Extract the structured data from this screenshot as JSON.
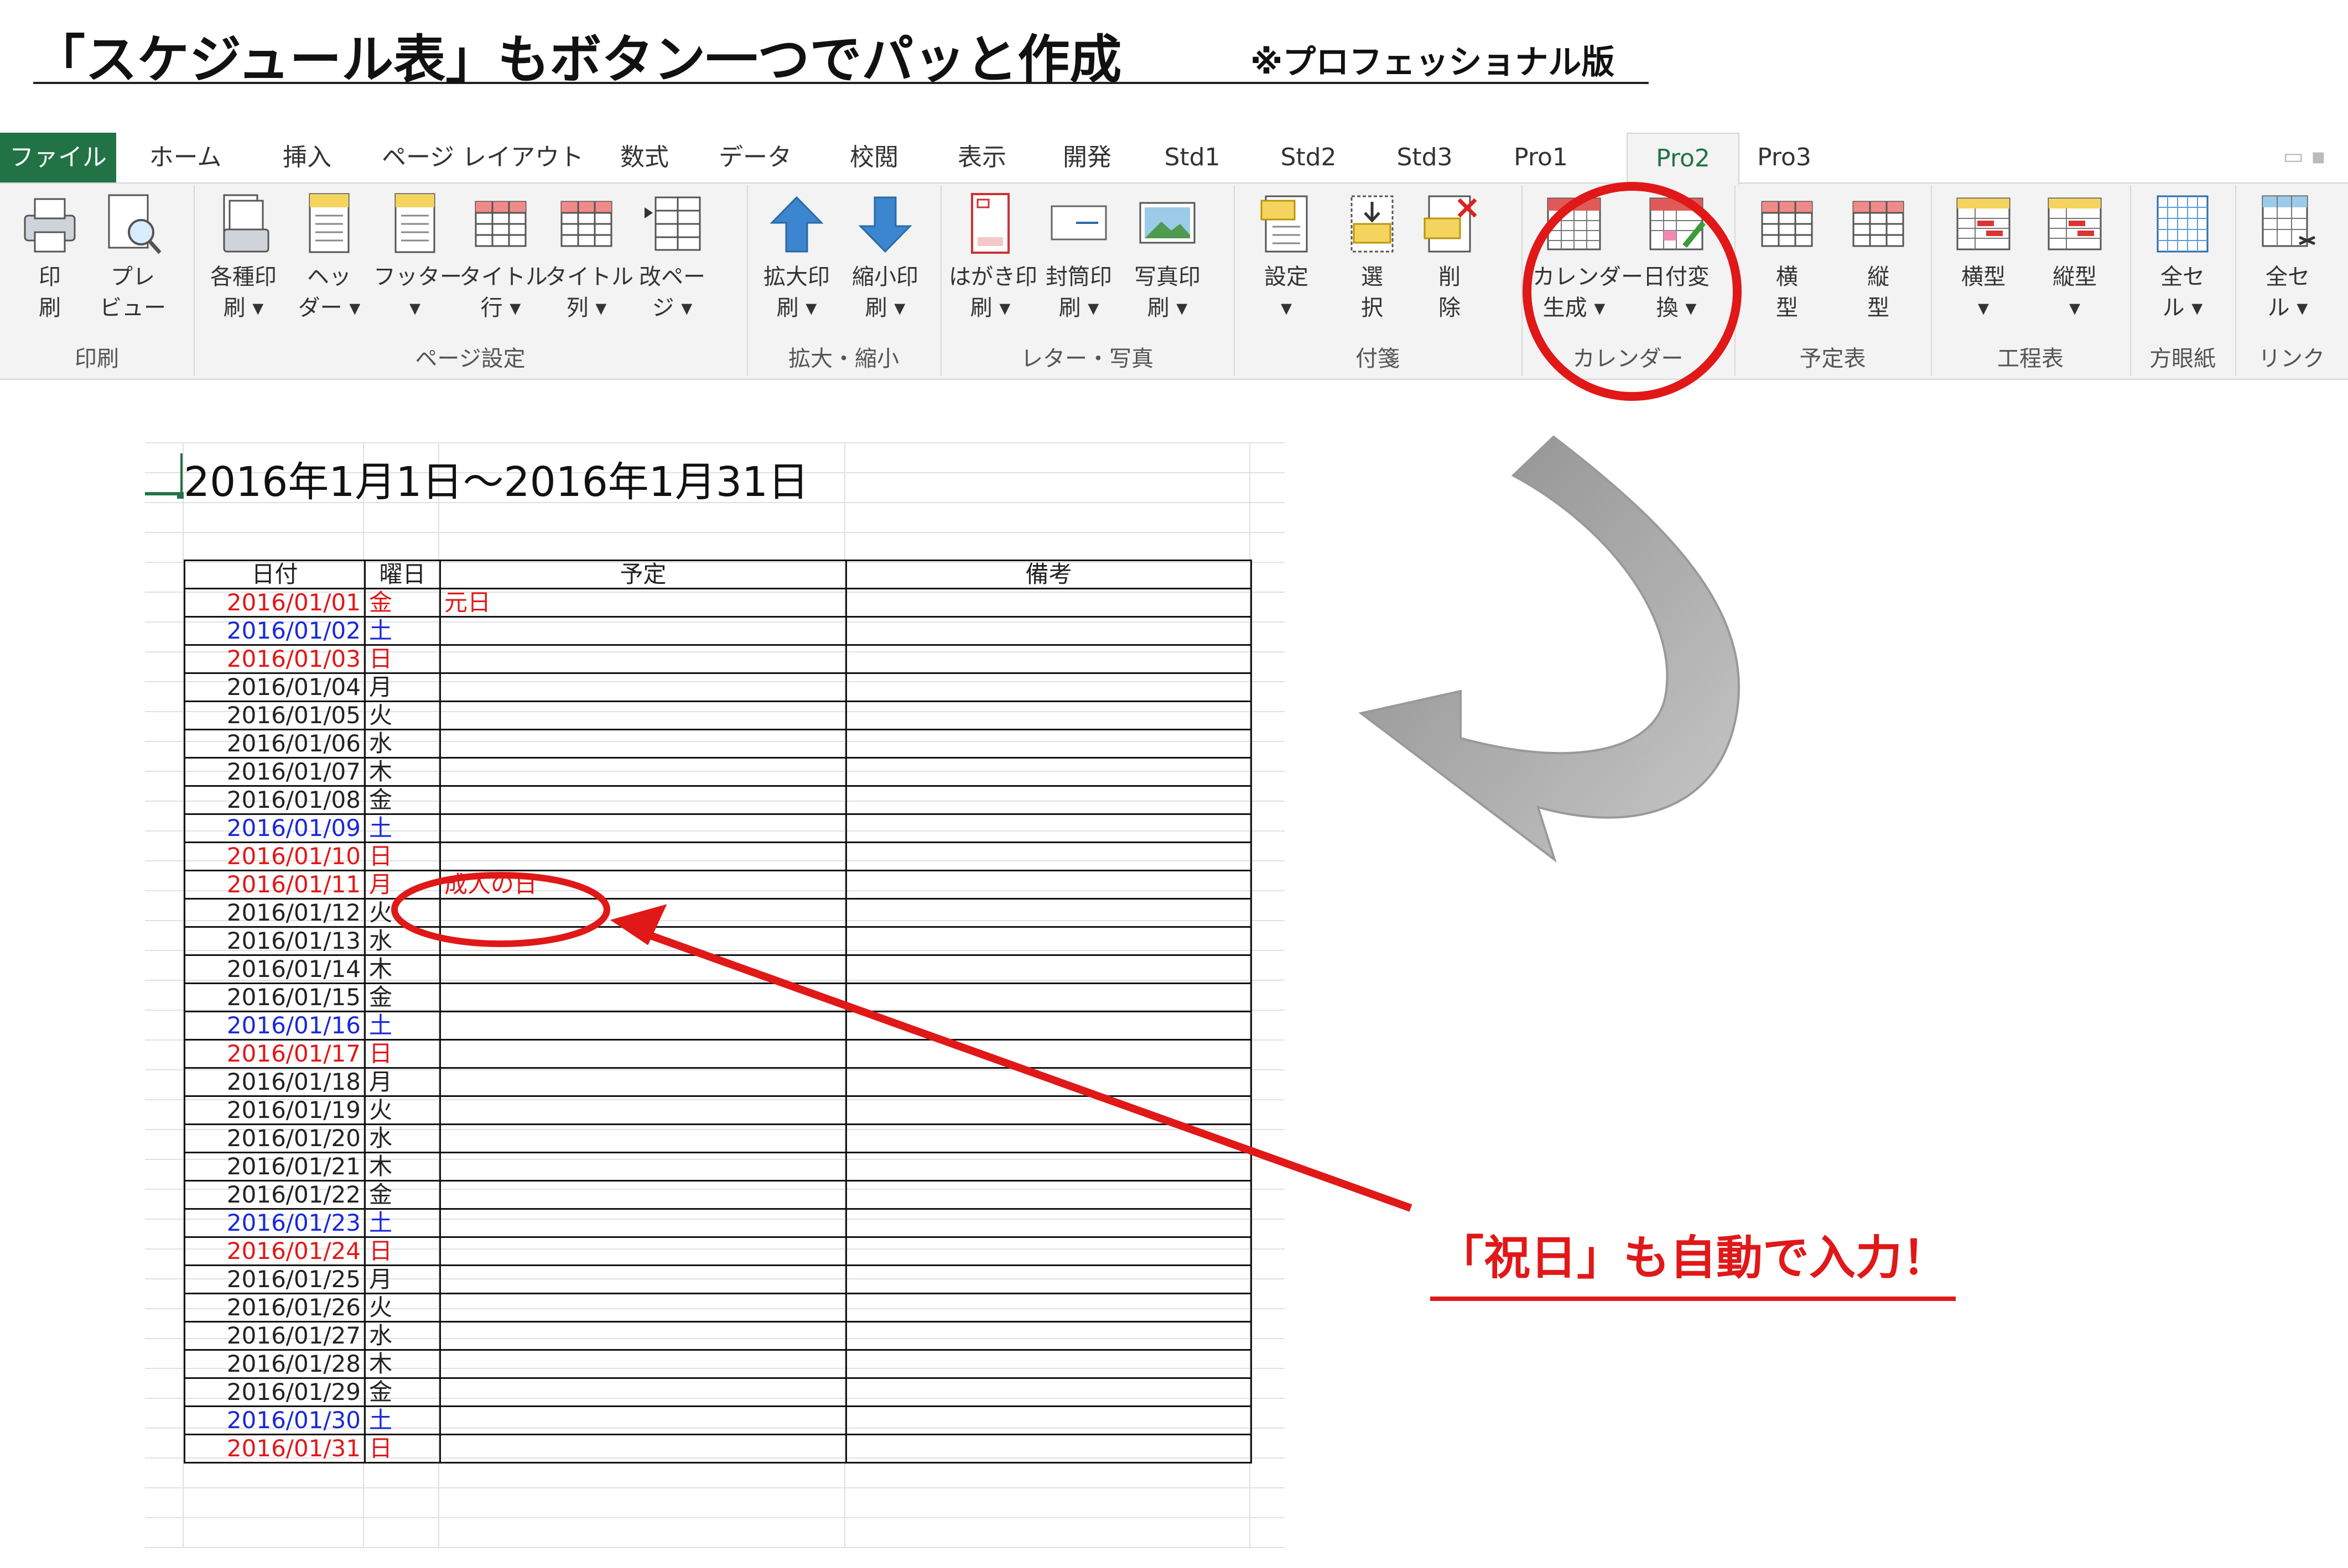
{
  "headline": {
    "title": "「スケジュール表」もボタン一つでパッと作成",
    "note": "※プロフェッショナル版"
  },
  "ribbon": {
    "tabs": [
      {
        "label": "ファイル",
        "state": "file"
      },
      {
        "label": "ホーム"
      },
      {
        "label": "挿入"
      },
      {
        "label": "ページ レイアウト"
      },
      {
        "label": "数式"
      },
      {
        "label": "データ"
      },
      {
        "label": "校閲"
      },
      {
        "label": "表示"
      },
      {
        "label": "開発"
      },
      {
        "label": "Std1"
      },
      {
        "label": "Std2"
      },
      {
        "label": "Std3"
      },
      {
        "label": "Pro1"
      },
      {
        "label": "Pro2",
        "state": "active"
      },
      {
        "label": "Pro3"
      }
    ],
    "groups": [
      {
        "label": "印刷",
        "buttons": [
          "印\n刷",
          "プレ\nビュー"
        ]
      },
      {
        "label": "ページ設定",
        "buttons": [
          "各種印\n刷 ▾",
          "ヘッ\nダー ▾",
          "フッター\n▾",
          "タイトル\n行 ▾",
          "タイトル\n列 ▾",
          "改ペー\nジ ▾"
        ]
      },
      {
        "label": "拡大・縮小",
        "buttons": [
          "拡大印\n刷 ▾",
          "縮小印\n刷 ▾"
        ]
      },
      {
        "label": "レター・写真",
        "buttons": [
          "はがき印\n刷 ▾",
          "封筒印\n刷 ▾",
          "写真印\n刷 ▾"
        ]
      },
      {
        "label": "付箋",
        "buttons": [
          "設定\n▾",
          "選\n択",
          "削\n除"
        ]
      },
      {
        "label": "カレンダー",
        "buttons": [
          "カレンダー\n生成 ▾",
          "日付変\n換 ▾"
        ]
      },
      {
        "label": "予定表",
        "buttons": [
          "横\n型",
          "縦\n型"
        ]
      },
      {
        "label": "工程表",
        "buttons": [
          "横型\n▾",
          "縦型\n▾"
        ]
      },
      {
        "label": "方眼紙",
        "buttons": [
          "全セ\nル ▾"
        ]
      },
      {
        "label": "リンク",
        "buttons": [
          "全セ\nル ▾"
        ]
      }
    ]
  },
  "sheet": {
    "title": "2016年1月1日～2016年1月31日",
    "headers": [
      "日付",
      "曜日",
      "予定",
      "備考"
    ],
    "rows": [
      {
        "date": "2016/01/01",
        "dow": "金",
        "plan": "元日",
        "color": "red"
      },
      {
        "date": "2016/01/02",
        "dow": "土",
        "plan": "",
        "color": "blue"
      },
      {
        "date": "2016/01/03",
        "dow": "日",
        "plan": "",
        "color": "red"
      },
      {
        "date": "2016/01/04",
        "dow": "月",
        "plan": "",
        "color": ""
      },
      {
        "date": "2016/01/05",
        "dow": "火",
        "plan": "",
        "color": ""
      },
      {
        "date": "2016/01/06",
        "dow": "水",
        "plan": "",
        "color": ""
      },
      {
        "date": "2016/01/07",
        "dow": "木",
        "plan": "",
        "color": ""
      },
      {
        "date": "2016/01/08",
        "dow": "金",
        "plan": "",
        "color": ""
      },
      {
        "date": "2016/01/09",
        "dow": "土",
        "plan": "",
        "color": "blue"
      },
      {
        "date": "2016/01/10",
        "dow": "日",
        "plan": "",
        "color": "red"
      },
      {
        "date": "2016/01/11",
        "dow": "月",
        "plan": "成人の日",
        "color": "red"
      },
      {
        "date": "2016/01/12",
        "dow": "火",
        "plan": "",
        "color": ""
      },
      {
        "date": "2016/01/13",
        "dow": "水",
        "plan": "",
        "color": ""
      },
      {
        "date": "2016/01/14",
        "dow": "木",
        "plan": "",
        "color": ""
      },
      {
        "date": "2016/01/15",
        "dow": "金",
        "plan": "",
        "color": ""
      },
      {
        "date": "2016/01/16",
        "dow": "土",
        "plan": "",
        "color": "blue"
      },
      {
        "date": "2016/01/17",
        "dow": "日",
        "plan": "",
        "color": "red"
      },
      {
        "date": "2016/01/18",
        "dow": "月",
        "plan": "",
        "color": ""
      },
      {
        "date": "2016/01/19",
        "dow": "火",
        "plan": "",
        "color": ""
      },
      {
        "date": "2016/01/20",
        "dow": "水",
        "plan": "",
        "color": ""
      },
      {
        "date": "2016/01/21",
        "dow": "木",
        "plan": "",
        "color": ""
      },
      {
        "date": "2016/01/22",
        "dow": "金",
        "plan": "",
        "color": ""
      },
      {
        "date": "2016/01/23",
        "dow": "土",
        "plan": "",
        "color": "blue"
      },
      {
        "date": "2016/01/24",
        "dow": "日",
        "plan": "",
        "color": "red"
      },
      {
        "date": "2016/01/25",
        "dow": "月",
        "plan": "",
        "color": ""
      },
      {
        "date": "2016/01/26",
        "dow": "火",
        "plan": "",
        "color": ""
      },
      {
        "date": "2016/01/27",
        "dow": "水",
        "plan": "",
        "color": ""
      },
      {
        "date": "2016/01/28",
        "dow": "木",
        "plan": "",
        "color": ""
      },
      {
        "date": "2016/01/29",
        "dow": "金",
        "plan": "",
        "color": ""
      },
      {
        "date": "2016/01/30",
        "dow": "土",
        "plan": "",
        "color": "blue"
      },
      {
        "date": "2016/01/31",
        "dow": "日",
        "plan": "",
        "color": "red"
      }
    ]
  },
  "callout": {
    "text": "「祝日」も自動で入力！"
  },
  "colors": {
    "excel_green": "#217346",
    "highlight_red": "#e01818",
    "weekend_blue": "#1a28d8",
    "arrow_gray": "#b3b3b3"
  }
}
